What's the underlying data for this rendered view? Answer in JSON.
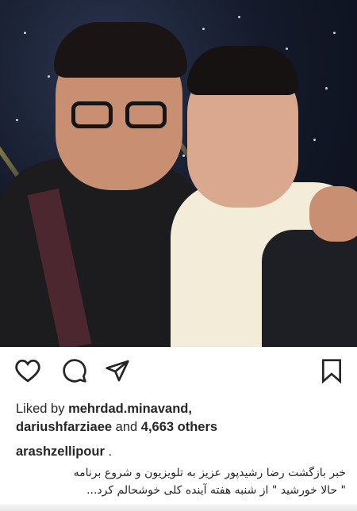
{
  "post": {
    "photo_alt": "Selfie of two men on a stage",
    "likes": {
      "prefix": "Liked by",
      "user1": "mehrdad.minavand,",
      "user2": "dariushfarziaee",
      "middle": "and",
      "count_text": "4,663 others"
    },
    "caption": {
      "username": "arashzellipour",
      "trail": ".",
      "lines": [
        "خبر بازگشت رضا رشیدپور عزیز به تلویزیون و شروع برنامه",
        "\" حالا خورشید \" از شنبه هفته آینده کلی خوشحالم کرد..."
      ]
    }
  },
  "icons": {
    "like": "heart-icon",
    "comment": "comment-icon",
    "share": "send-icon",
    "save": "bookmark-icon"
  },
  "colors": {
    "text": "#262626",
    "background": "#ffffff"
  }
}
